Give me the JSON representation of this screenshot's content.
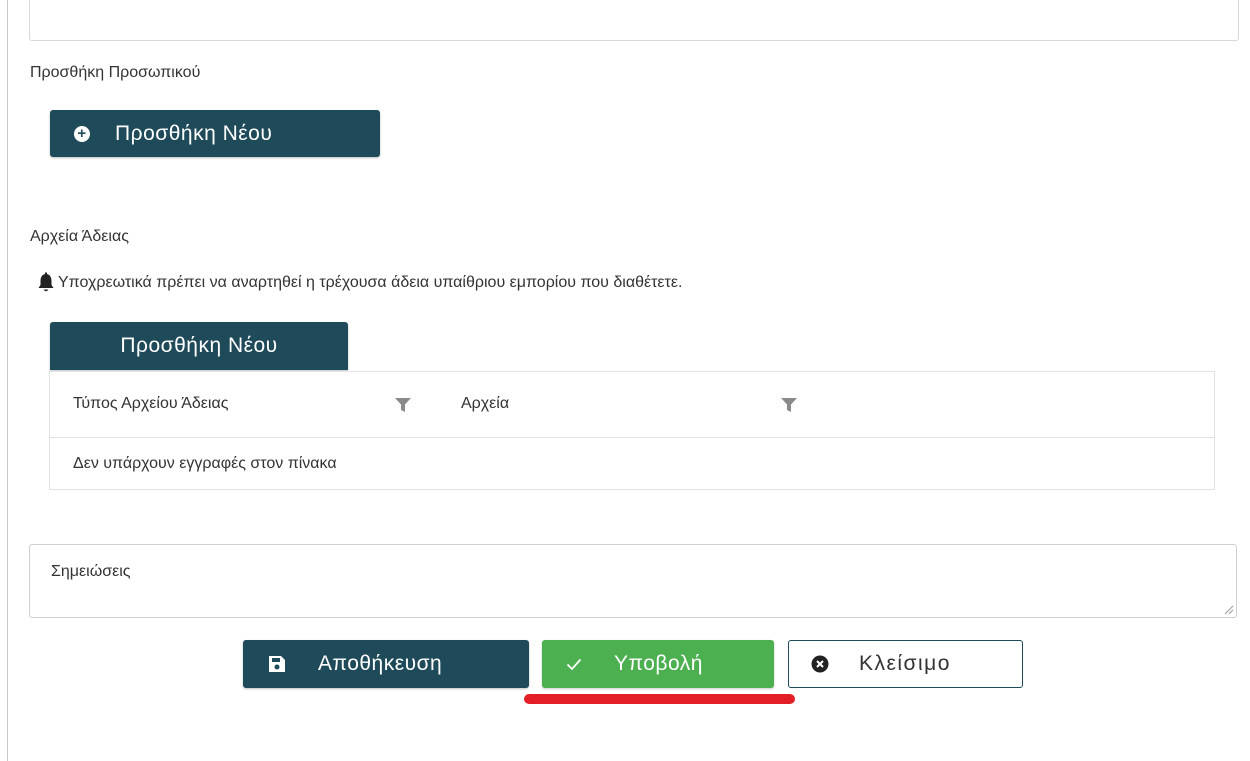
{
  "staff": {
    "label": "Προσθήκη Προσωπικού",
    "add_button": "Προσθήκη Νέου"
  },
  "license_files": {
    "label": "Αρχεία Άδειας",
    "notice": "Υποχρεωτικά πρέπει να αναρτηθεί η τρέχουσα άδεια υπαίθριου εμπορίου που διαθέτετε.",
    "add_button": "Προσθήκη Νέου",
    "table": {
      "columns": [
        "Τύπος Αρχείου Άδειας",
        "Αρχεία"
      ],
      "empty_text": "Δεν υπάρχουν εγγραφές στον πίνακα"
    }
  },
  "notes": {
    "placeholder": "Σημειώσεις"
  },
  "actions": {
    "save": "Αποθήκευση",
    "submit": "Υποβολή",
    "close": "Κλείσιμο"
  },
  "colors": {
    "primary": "#1f4a5a",
    "success": "#4caf50",
    "highlight": "#e21f26"
  },
  "icons": {
    "add": "plus-circle-icon",
    "bell": "bell-icon",
    "filter": "filter-icon",
    "save": "floppy-disk-icon",
    "submit": "check-icon",
    "close": "close-circle-icon"
  }
}
